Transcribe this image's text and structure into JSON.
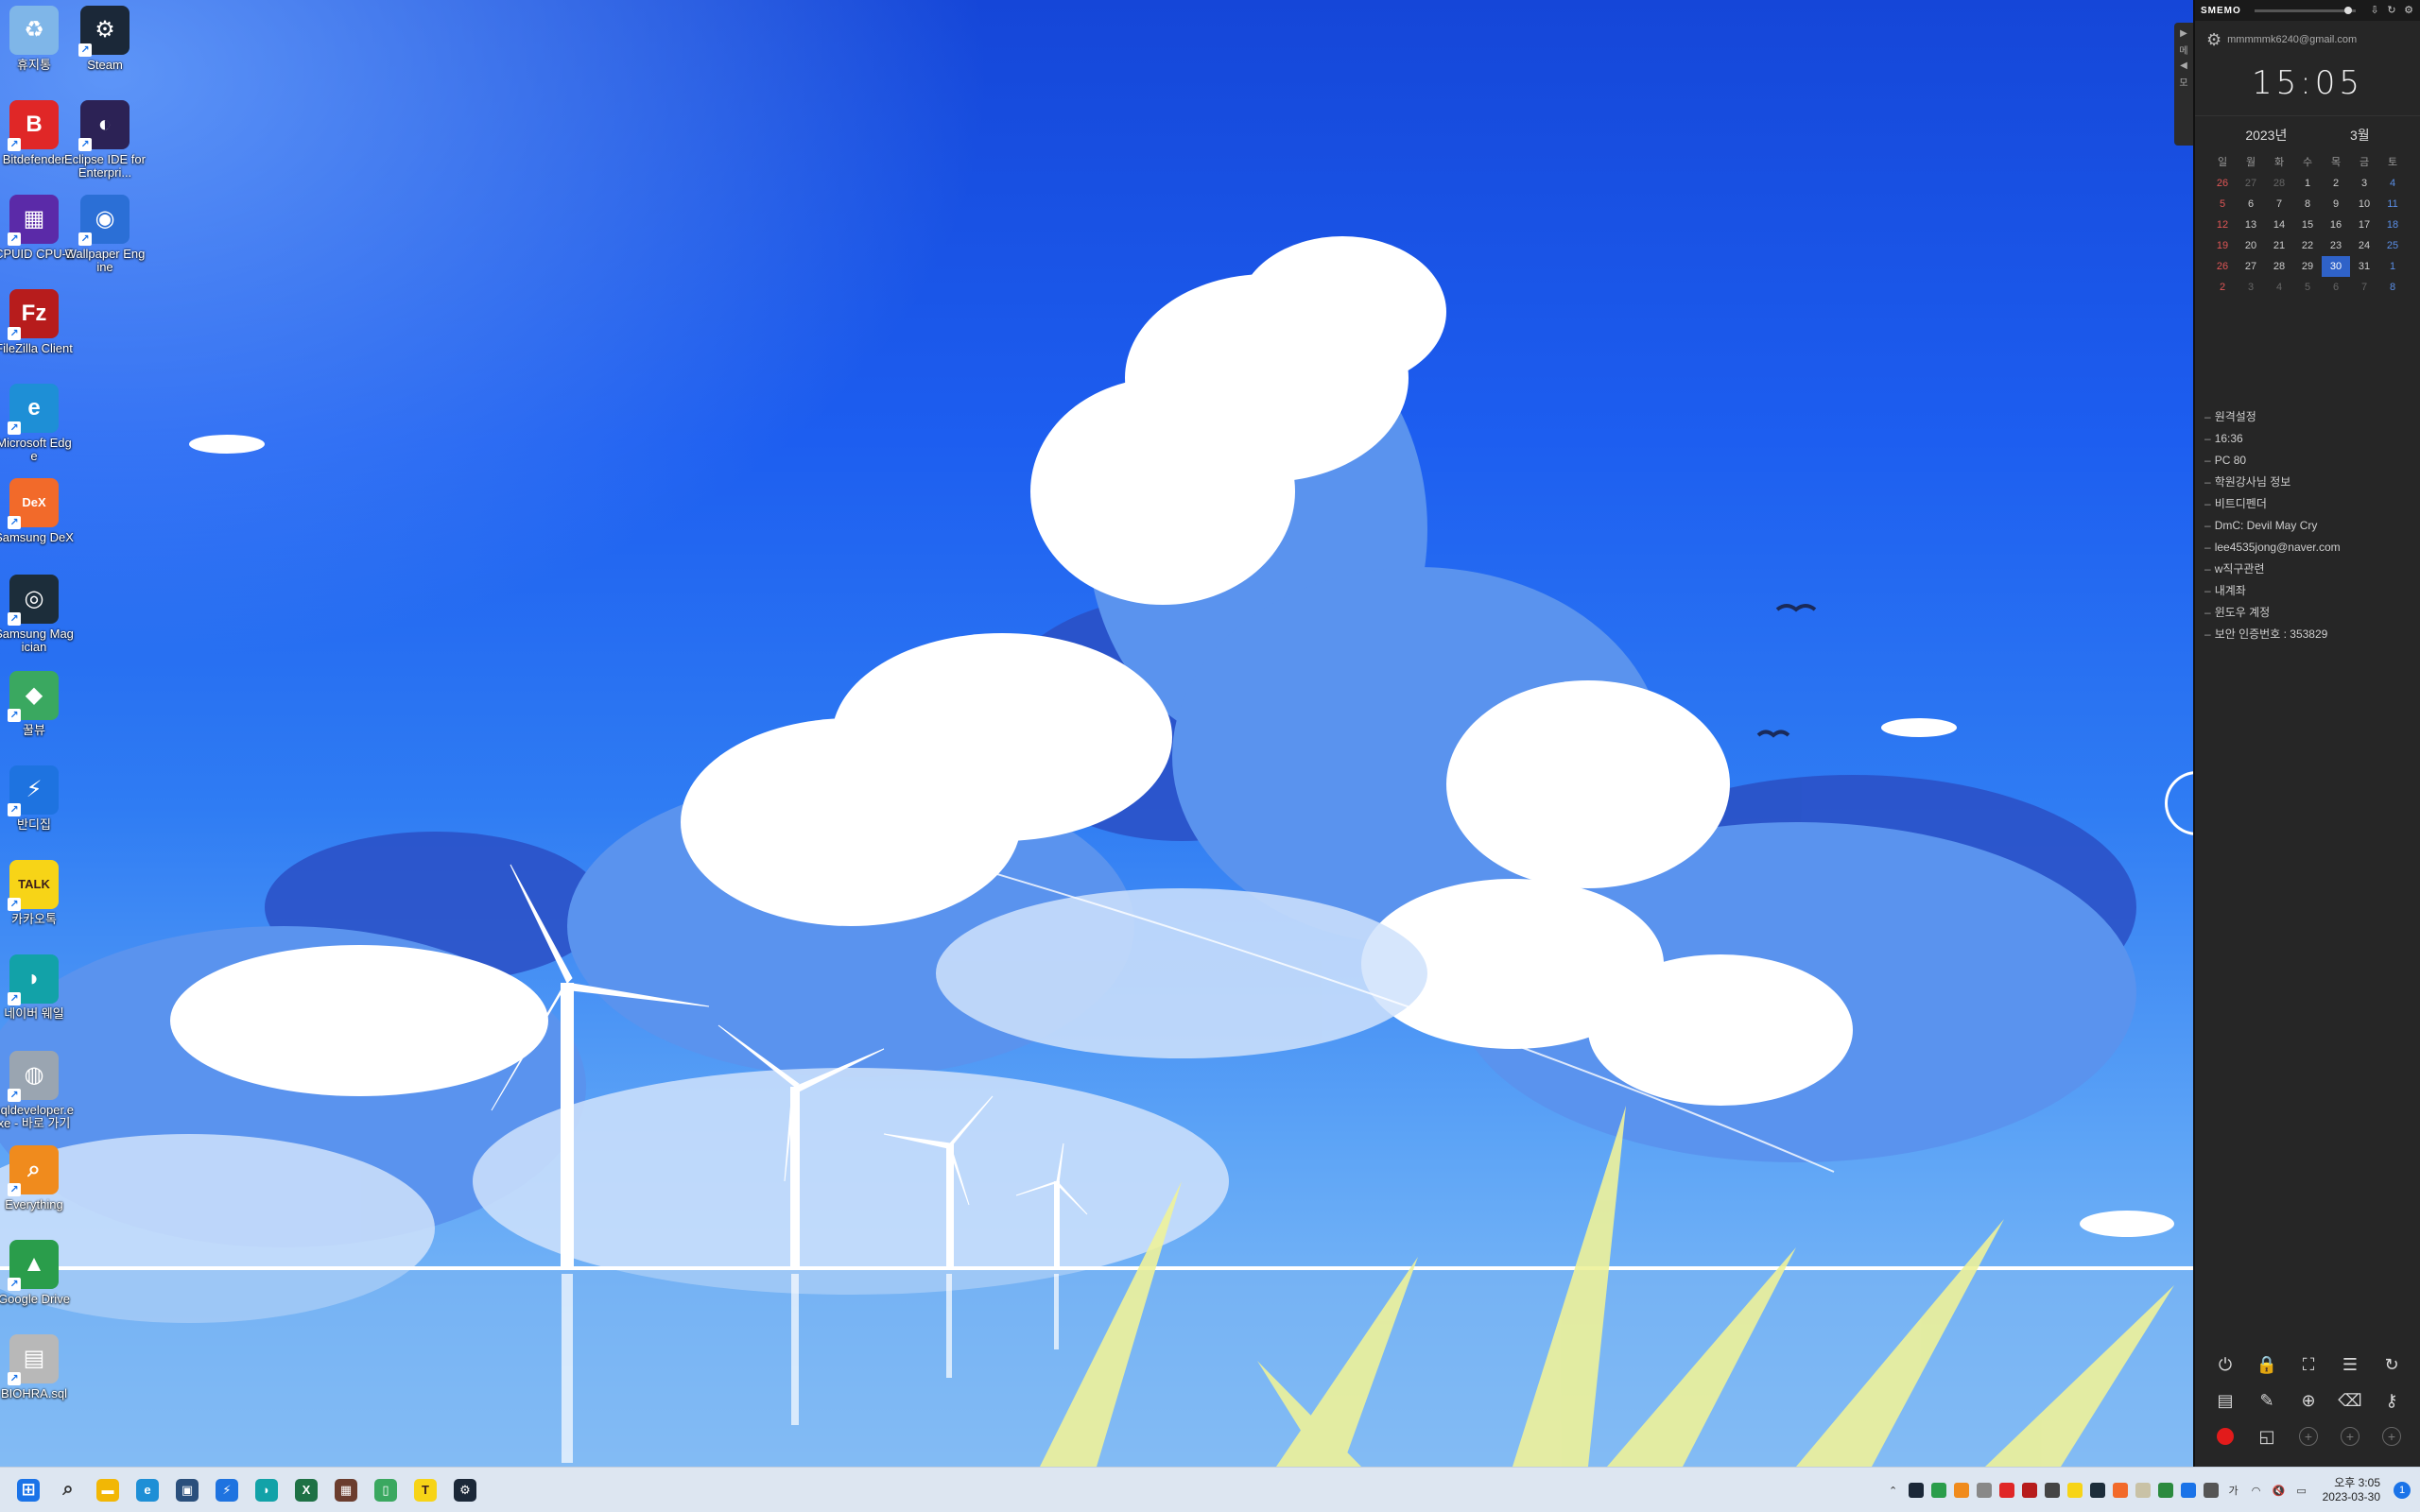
{
  "desktop": {
    "icons": [
      {
        "label": "휴지통",
        "name": "recycle-bin-icon",
        "color": "#7fb6e8",
        "glyph": "♻"
      },
      {
        "label": "Steam",
        "name": "steam-icon",
        "color": "#1b2838",
        "glyph": "⚙"
      },
      {
        "label": "Bitdefender",
        "name": "bitdefender-icon",
        "color": "#e02727",
        "glyph": "B"
      },
      {
        "label": "Eclipse IDE for Enterpri...",
        "name": "eclipse-icon",
        "color": "#2c2255",
        "glyph": "◐"
      },
      {
        "label": "CPUID CPU-Z",
        "name": "cpuz-icon",
        "color": "#5b2aa8",
        "glyph": "▦"
      },
      {
        "label": "Wallpaper Engine",
        "name": "wallpaper-engine-icon",
        "color": "#2b6fd6",
        "glyph": "◉"
      },
      {
        "label": "FileZilla Client",
        "name": "filezilla-icon",
        "color": "#b71c1c",
        "glyph": "Fz"
      },
      {
        "label": "Microsoft Edge",
        "name": "edge-icon",
        "color": "#1e8fd6",
        "glyph": "e"
      },
      {
        "label": "Samsung DeX",
        "name": "samsung-dex-icon",
        "color": "#f26a2a",
        "glyph": "DeX"
      },
      {
        "label": "Samsung Magician",
        "name": "samsung-magician-icon",
        "color": "#1c2d3a",
        "glyph": "◎"
      },
      {
        "label": "꿀뷰",
        "name": "honeyview-icon",
        "color": "#3aa860",
        "glyph": "◆"
      },
      {
        "label": "반디집",
        "name": "bandizip-icon",
        "color": "#1e73e0",
        "glyph": "⚡"
      },
      {
        "label": "카카오톡",
        "name": "kakaotalk-icon",
        "color": "#f7d417",
        "glyph": "TALK"
      },
      {
        "label": "네이버 웨일",
        "name": "naver-whale-icon",
        "color": "#12a2a8",
        "glyph": "◗"
      },
      {
        "label": "sqldeveloper.exe - 바로 가기",
        "name": "sqldeveloper-icon",
        "color": "#9aa5b1",
        "glyph": "◍"
      },
      {
        "label": "Everything",
        "name": "everything-icon",
        "color": "#f08b1d",
        "glyph": "⌕"
      },
      {
        "label": "Google Drive",
        "name": "google-drive-icon",
        "color": "#2a9d4b",
        "glyph": "▲"
      },
      {
        "label": "BIOHRA.sql",
        "name": "sql-file-icon",
        "color": "#b8b8b8",
        "glyph": "▤"
      }
    ]
  },
  "memo": {
    "brand": "SMEMO",
    "account": "mmmmmk6240@gmail.com",
    "clock": "15:05",
    "year": "2023년",
    "month": "3월",
    "weekdays": [
      "일",
      "월",
      "화",
      "수",
      "목",
      "금",
      "토"
    ],
    "weeks": [
      [
        "26",
        "27",
        "28",
        "1",
        "2",
        "3",
        "4"
      ],
      [
        "5",
        "6",
        "7",
        "8",
        "9",
        "10",
        "11"
      ],
      [
        "12",
        "13",
        "14",
        "15",
        "16",
        "17",
        "18"
      ],
      [
        "19",
        "20",
        "21",
        "22",
        "23",
        "24",
        "25"
      ],
      [
        "26",
        "27",
        "28",
        "29",
        "30",
        "31",
        "1"
      ],
      [
        "2",
        "3",
        "4",
        "5",
        "6",
        "7",
        "8"
      ]
    ],
    "today": "30",
    "items": [
      "원격설정",
      "16:36",
      "PC 80",
      "학원강사님 정보",
      "비트디펜더",
      "DmC: Devil May Cry",
      "lee4535jong@naver.com",
      "w직구관련",
      "내계좌",
      "윈도우 계정",
      "보안 인증번호 : 353829"
    ],
    "side_tab": [
      "메",
      "모"
    ],
    "tools": [
      {
        "name": "power-icon",
        "glyph": "⏻"
      },
      {
        "name": "lock-icon",
        "glyph": "🔒"
      },
      {
        "name": "screenshot-icon",
        "glyph": "⛶"
      },
      {
        "name": "checklist-icon",
        "glyph": "☰"
      },
      {
        "name": "refresh-icon",
        "glyph": "↻"
      },
      {
        "name": "notebook-icon",
        "glyph": "▤"
      },
      {
        "name": "pen-icon",
        "glyph": "✎"
      },
      {
        "name": "zoom-icon",
        "glyph": "⊕"
      },
      {
        "name": "eraser-icon",
        "glyph": "⌫"
      },
      {
        "name": "key-icon",
        "glyph": "⚷"
      },
      {
        "name": "record-icon",
        "glyph": "rec"
      },
      {
        "name": "window-icon",
        "glyph": "◱"
      },
      {
        "name": "add-slot-icon",
        "glyph": "+"
      },
      {
        "name": "add-slot-icon",
        "glyph": "+"
      },
      {
        "name": "add-slot-icon",
        "glyph": "+"
      }
    ]
  },
  "taskbar": {
    "apps": [
      {
        "name": "start-icon",
        "color": "#1a73e8",
        "glyph": "⊞"
      },
      {
        "name": "search-icon",
        "color": "#333333",
        "glyph": "⌕"
      },
      {
        "name": "file-explorer-icon",
        "color": "#f2b705",
        "glyph": "▬"
      },
      {
        "name": "edge-icon",
        "color": "#1e8fd6",
        "glyph": "e"
      },
      {
        "name": "store-icon",
        "color": "#2a4f7c",
        "glyph": "▣"
      },
      {
        "name": "bandizip-icon",
        "color": "#1e73e0",
        "glyph": "⚡"
      },
      {
        "name": "whale-icon",
        "color": "#12a2a8",
        "glyph": "◗"
      },
      {
        "name": "excel-icon",
        "color": "#1e7145",
        "glyph": "X"
      },
      {
        "name": "app-icon",
        "color": "#6b3d2e",
        "glyph": "▦"
      },
      {
        "name": "phone-link-icon",
        "color": "#3aa860",
        "glyph": "▯"
      },
      {
        "name": "kakaotalk-icon",
        "color": "#f7d417",
        "glyph": "T"
      },
      {
        "name": "steam-icon",
        "color": "#1b2838",
        "glyph": "⚙"
      }
    ],
    "tray": [
      {
        "name": "chevron-up-icon",
        "color": "",
        "glyph": "⌃"
      },
      {
        "name": "steam-tray-icon",
        "color": "#1b2838",
        "glyph": ""
      },
      {
        "name": "google-drive-tray-icon",
        "color": "#2a9d4b",
        "glyph": ""
      },
      {
        "name": "everything-tray-icon",
        "color": "#f08b1d",
        "glyph": ""
      },
      {
        "name": "onedrive-icon",
        "color": "#888888",
        "glyph": ""
      },
      {
        "name": "bitdefender-tray-icon",
        "color": "#e02727",
        "glyph": ""
      },
      {
        "name": "filezilla-tray-icon",
        "color": "#b71c1c",
        "glyph": ""
      },
      {
        "name": "samsung-tray-icon",
        "color": "#444444",
        "glyph": ""
      },
      {
        "name": "kakaotalk-tray-icon",
        "color": "#f7d417",
        "glyph": ""
      },
      {
        "name": "app-tray-icon",
        "color": "#1c2d3a",
        "glyph": ""
      },
      {
        "name": "smemo-tray-icon",
        "color": "#f26a2a",
        "glyph": ""
      },
      {
        "name": "app-tray-icon",
        "color": "#c9c2a6",
        "glyph": ""
      },
      {
        "name": "security-tray-icon",
        "color": "#2b8a3e",
        "glyph": ""
      },
      {
        "name": "bluetooth-icon",
        "color": "#1a73e8",
        "glyph": ""
      },
      {
        "name": "app-tray-icon",
        "color": "#555555",
        "glyph": ""
      },
      {
        "name": "input-method-icon",
        "color": "",
        "glyph": "가"
      },
      {
        "name": "wifi-icon",
        "color": "",
        "glyph": "◠"
      },
      {
        "name": "volume-icon",
        "color": "",
        "glyph": "🔇"
      },
      {
        "name": "battery-icon",
        "color": "",
        "glyph": "▭"
      }
    ],
    "time": "오후 3:05",
    "date": "2023-03-30",
    "notification_count": "1"
  }
}
